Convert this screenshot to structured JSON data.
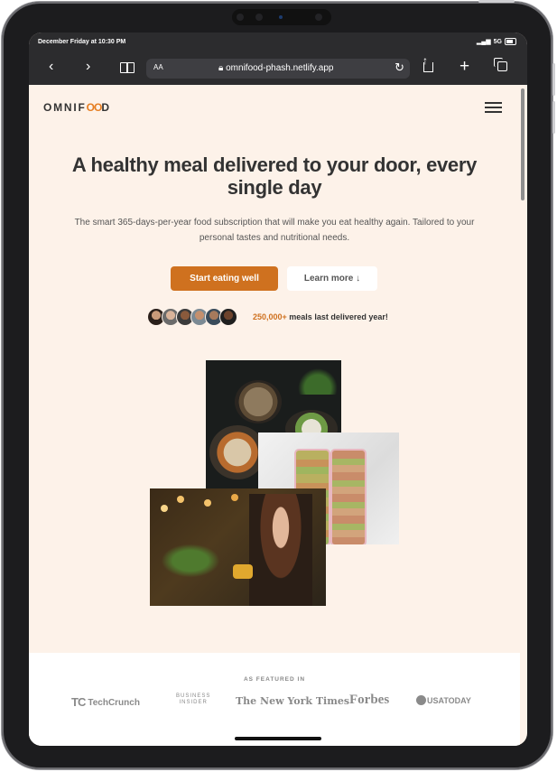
{
  "device": {
    "status_time": "December Friday at 10:30 PM",
    "signal": "5G"
  },
  "browser": {
    "aa_label": "AA",
    "url": "omnifood-phash.netlify.app",
    "back_icon": "‹",
    "forward_icon": "›",
    "new_tab_icon": "+",
    "reload_icon": "↻"
  },
  "nav": {
    "logo_pre": "OMNIF",
    "logo_oo": "OO",
    "logo_post": "D"
  },
  "hero": {
    "title": "A healthy meal delivered to your door, every single day",
    "subtitle": "The smart 365-days-per-year food subscription that will make you eat healthy again. Tailored to your personal tastes and nutritional needs.",
    "primary_button": "Start eating well",
    "secondary_button": "Learn more ↓",
    "delivered_count": "250,000+",
    "delivered_text": " meals last delivered year!"
  },
  "featured": {
    "title": "AS FEATURED IN",
    "logos": {
      "techcrunch": "TechCrunch",
      "techcrunch_mark": "TC",
      "business_insider_1": "BUSINESS",
      "business_insider_2": "INSIDER",
      "nyt": "The New York Times",
      "forbes": "Forbes",
      "usatoday": "USATODAY"
    }
  },
  "colors": {
    "accent": "#cf711f",
    "page_bg": "#fdf2e9"
  }
}
